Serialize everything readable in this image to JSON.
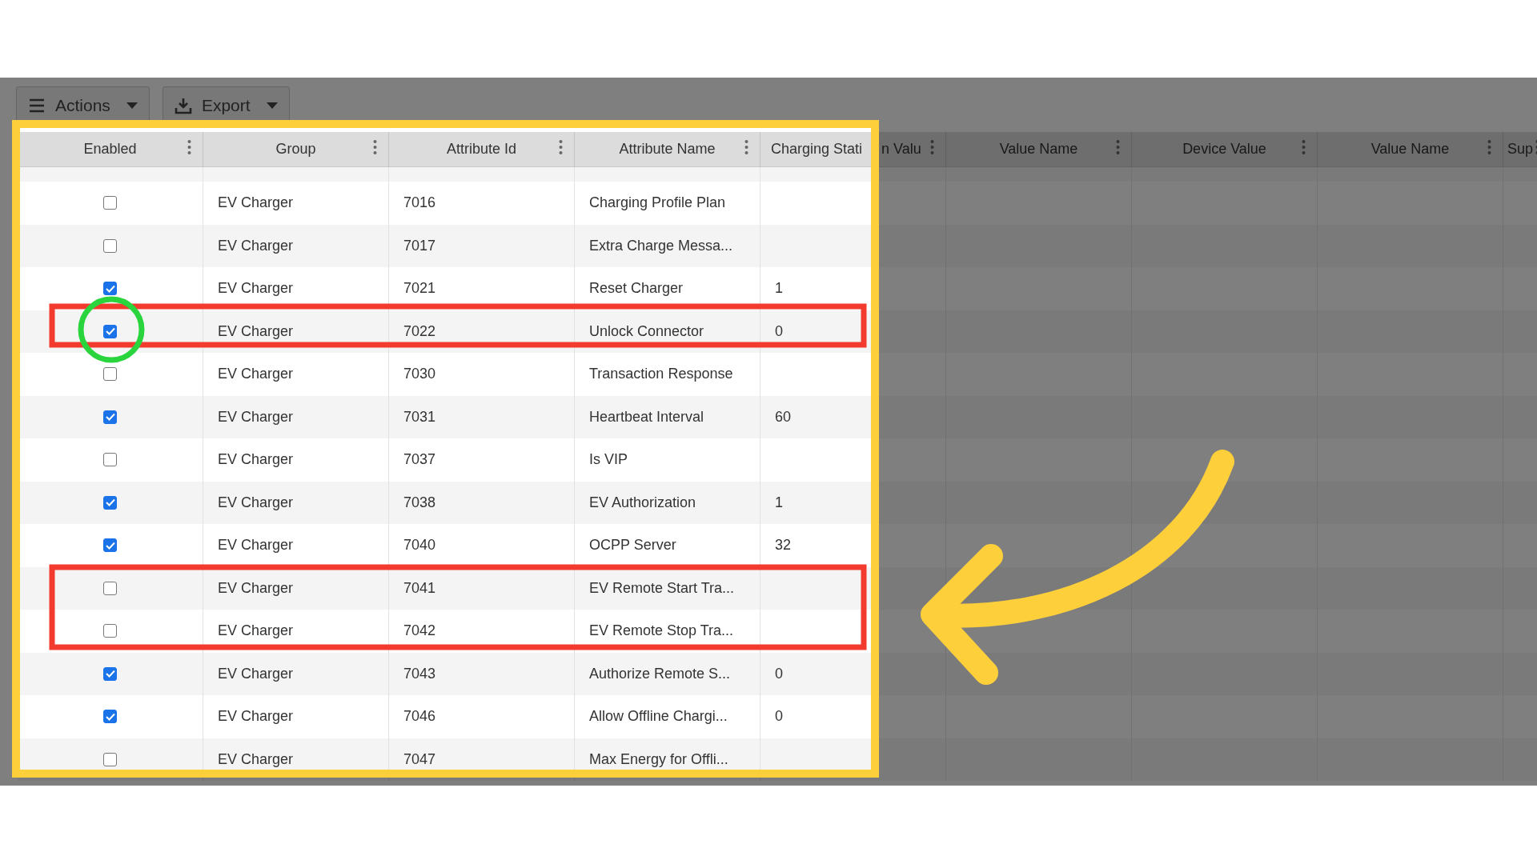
{
  "toolbar": [
    {
      "kind": "menu",
      "label": "Actions"
    },
    {
      "kind": "download",
      "label": "Export"
    }
  ],
  "columns": [
    {
      "label": "Enabled"
    },
    {
      "label": "Group"
    },
    {
      "label": "Attribute Id"
    },
    {
      "label": "Attribute Name"
    },
    {
      "label": "Charging Stati",
      "label_continued": "n Valu"
    },
    {
      "label": "Value Name"
    },
    {
      "label": "Device Value"
    },
    {
      "label": "Value Name"
    },
    {
      "label": "Sup"
    }
  ],
  "rows": [
    {
      "enabled": false,
      "group": "EV Charger",
      "attribute_id": "7016",
      "attribute_name": "Charging Profile Plan"
    },
    {
      "enabled": false,
      "group": "EV Charger",
      "attribute_id": "7017",
      "attribute_name": "Extra Charge Messa..."
    },
    {
      "enabled": true,
      "group": "EV Charger",
      "attribute_id": "7021",
      "attribute_name": "Reset Charger",
      "charging_station_value": "1"
    },
    {
      "enabled": true,
      "group": "EV Charger",
      "attribute_id": "7022",
      "attribute_name": "Unlock Connector",
      "charging_station_value": "0"
    },
    {
      "enabled": false,
      "group": "EV Charger",
      "attribute_id": "7030",
      "attribute_name": "Transaction Response"
    },
    {
      "enabled": true,
      "group": "EV Charger",
      "attribute_id": "7031",
      "attribute_name": "Heartbeat Interval",
      "charging_station_value": "60"
    },
    {
      "enabled": false,
      "group": "EV Charger",
      "attribute_id": "7037",
      "attribute_name": "Is VIP"
    },
    {
      "enabled": true,
      "group": "EV Charger",
      "attribute_id": "7038",
      "attribute_name": "EV Authorization",
      "charging_station_value": "1"
    },
    {
      "enabled": true,
      "group": "EV Charger",
      "attribute_id": "7040",
      "attribute_name": "OCPP Server",
      "charging_station_value": "32"
    },
    {
      "enabled": false,
      "group": "EV Charger",
      "attribute_id": "7041",
      "attribute_name": "EV Remote Start Tra..."
    },
    {
      "enabled": false,
      "group": "EV Charger",
      "attribute_id": "7042",
      "attribute_name": "EV Remote Stop Tra..."
    },
    {
      "enabled": true,
      "group": "EV Charger",
      "attribute_id": "7043",
      "attribute_name": "Authorize Remote S...",
      "charging_station_value": "0"
    },
    {
      "enabled": true,
      "group": "EV Charger",
      "attribute_id": "7046",
      "attribute_name": "Allow Offline Chargi...",
      "charging_station_value": "0"
    },
    {
      "enabled": false,
      "group": "EV Charger",
      "attribute_id": "7047",
      "attribute_name": "Max Energy for Offli..."
    }
  ]
}
